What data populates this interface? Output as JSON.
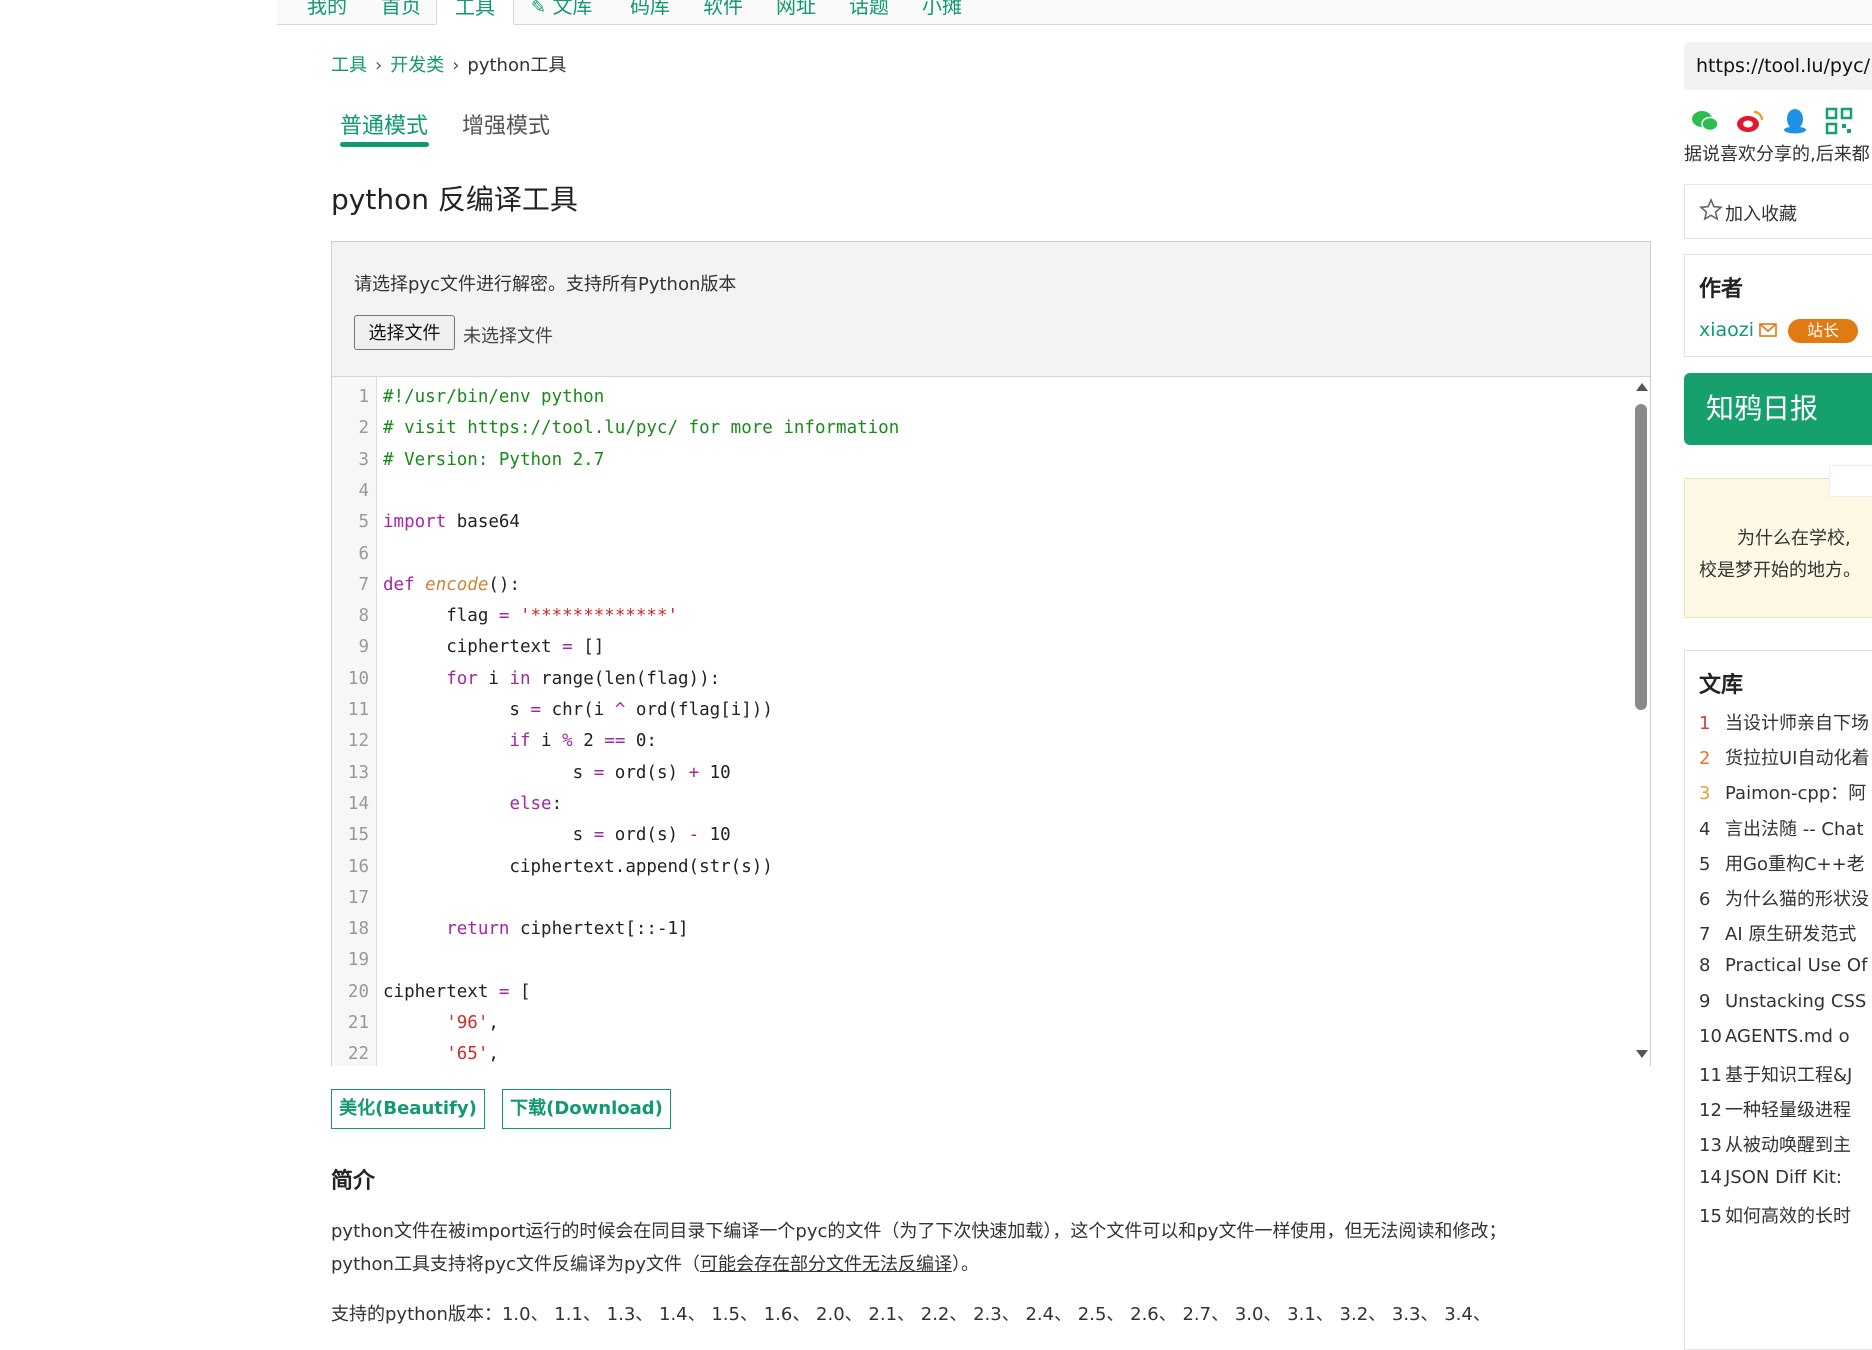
{
  "nav": {
    "items": [
      "我的",
      "首页",
      "工具",
      "文库",
      "码库",
      "软件",
      "网址",
      "话题",
      "小摊"
    ],
    "active_index": 2
  },
  "breadcrumb": {
    "tools": "工具",
    "dev": "开发类",
    "current": "python工具",
    "sep": "›"
  },
  "tabs": {
    "normal": "普通模式",
    "enhanced": "增强模式"
  },
  "page_title": "python 反编译工具",
  "panel": {
    "hint": "请选择pyc文件进行解密。支持所有Python版本",
    "file_button": "选择文件",
    "file_status": "未选择文件"
  },
  "code_lines": [
    {
      "n": "1",
      "parts": [
        [
          "c-com",
          "#!/usr/bin/env python"
        ]
      ]
    },
    {
      "n": "2",
      "parts": [
        [
          "c-com",
          "# visit https://tool.lu/pyc/ for more information"
        ]
      ]
    },
    {
      "n": "3",
      "parts": [
        [
          "c-com",
          "# Version: Python 2.7"
        ]
      ]
    },
    {
      "n": "4",
      "parts": []
    },
    {
      "n": "5",
      "parts": [
        [
          "c-kw",
          "import"
        ],
        [
          "",
          " base64"
        ]
      ]
    },
    {
      "n": "6",
      "parts": []
    },
    {
      "n": "7",
      "parts": [
        [
          "c-kw",
          "def"
        ],
        [
          "",
          " "
        ],
        [
          "c-fn",
          "encode"
        ],
        [
          "",
          "():"
        ]
      ]
    },
    {
      "n": "8",
      "parts": [
        [
          "",
          "      flag "
        ],
        [
          "c-op",
          "="
        ],
        [
          "",
          " "
        ],
        [
          "c-str",
          "'*************'"
        ]
      ]
    },
    {
      "n": "9",
      "parts": [
        [
          "",
          "      ciphertext "
        ],
        [
          "c-op",
          "="
        ],
        [
          "",
          " []"
        ]
      ]
    },
    {
      "n": "10",
      "parts": [
        [
          "",
          "      "
        ],
        [
          "c-kw",
          "for"
        ],
        [
          "",
          " i "
        ],
        [
          "c-kw",
          "in"
        ],
        [
          "",
          " range(len(flag)):"
        ]
      ]
    },
    {
      "n": "11",
      "parts": [
        [
          "",
          "            s "
        ],
        [
          "c-op",
          "="
        ],
        [
          "",
          " chr(i "
        ],
        [
          "c-op",
          "^"
        ],
        [
          "",
          " ord(flag[i]))"
        ]
      ]
    },
    {
      "n": "12",
      "parts": [
        [
          "",
          "            "
        ],
        [
          "c-kw",
          "if"
        ],
        [
          "",
          " i "
        ],
        [
          "c-op",
          "%"
        ],
        [
          "",
          " 2 "
        ],
        [
          "c-op",
          "=="
        ],
        [
          "",
          " 0:"
        ]
      ]
    },
    {
      "n": "13",
      "parts": [
        [
          "",
          "                  s "
        ],
        [
          "c-op",
          "="
        ],
        [
          "",
          " ord(s) "
        ],
        [
          "c-op",
          "+"
        ],
        [
          "",
          " 10"
        ]
      ]
    },
    {
      "n": "14",
      "parts": [
        [
          "",
          "            "
        ],
        [
          "c-kw",
          "else"
        ],
        [
          "",
          ":"
        ]
      ]
    },
    {
      "n": "15",
      "parts": [
        [
          "",
          "                  s "
        ],
        [
          "c-op",
          "="
        ],
        [
          "",
          " ord(s) "
        ],
        [
          "c-op",
          "-"
        ],
        [
          "",
          " 10"
        ]
      ]
    },
    {
      "n": "16",
      "parts": [
        [
          "",
          "            ciphertext.append(str(s))"
        ]
      ]
    },
    {
      "n": "17",
      "parts": []
    },
    {
      "n": "18",
      "parts": [
        [
          "",
          "      "
        ],
        [
          "c-kw",
          "return"
        ],
        [
          "",
          " ciphertext[::-1]"
        ]
      ]
    },
    {
      "n": "19",
      "parts": []
    },
    {
      "n": "20",
      "parts": [
        [
          "",
          "ciphertext "
        ],
        [
          "c-op",
          "="
        ],
        [
          "",
          " ["
        ]
      ]
    },
    {
      "n": "21",
      "parts": [
        [
          "",
          "      "
        ],
        [
          "c-str",
          "'96'"
        ],
        [
          "",
          ","
        ]
      ]
    },
    {
      "n": "22",
      "parts": [
        [
          "",
          "      "
        ],
        [
          "c-str",
          "'65'"
        ],
        [
          "",
          ","
        ]
      ]
    }
  ],
  "actions": {
    "beautify": "美化(Beautify)",
    "download": "下载(Download)"
  },
  "intro": {
    "heading": "简介",
    "p1": "python文件在被import运行的时候会在同目录下编译一个pyc的文件（为了下次快速加载），这个文件可以和py文件一样使用，但无法阅读和修改；",
    "p2_a": "python工具支持将pyc文件反编译为py文件（",
    "p2_link": "可能会存在部分文件无法反编译",
    "p2_b": "）。",
    "p3": "支持的python版本：1.0、 1.1、 1.3、 1.4、 1.5、 1.6、 2.0、 2.1、 2.2、 2.3、 2.4、 2.5、 2.6、 2.7、 3.0、 3.1、 3.2、 3.3、 3.4、"
  },
  "sidebar": {
    "url": "https://tool.lu/pyc/",
    "share_icons": [
      "wechat-icon",
      "weibo-icon",
      "qq-icon",
      "qrcode-icon",
      "bookmark-icon"
    ],
    "share_note": "据说喜欢分享的,后来都",
    "favorite": "加入收藏",
    "author_heading": "作者",
    "author_name": "xiaozi",
    "author_badge": "站长",
    "daily": "知鸦日报",
    "note_line1": "为什么在学校,",
    "note_line2": "校是梦开始的地方。",
    "lib_heading": "文库",
    "lib_items": [
      {
        "n": "1",
        "title": "当设计师亲自下场",
        "color": "#e03b3b"
      },
      {
        "n": "2",
        "title": "货拉拉UI自动化着",
        "color": "#e8732a"
      },
      {
        "n": "3",
        "title": "Paimon-cpp：阿",
        "color": "#e8a32a"
      },
      {
        "n": "4",
        "title": "言出法随 -- Chat",
        "color": "#333333"
      },
      {
        "n": "5",
        "title": "用Go重构C++老",
        "color": "#333333"
      },
      {
        "n": "6",
        "title": "为什么猫的形状没",
        "color": "#333333"
      },
      {
        "n": "7",
        "title": "AI 原生研发范式",
        "color": "#333333"
      },
      {
        "n": "8",
        "title": "Practical Use Of",
        "color": "#333333"
      },
      {
        "n": "9",
        "title": "Unstacking CSS",
        "color": "#333333"
      },
      {
        "n": "10",
        "title": "AGENTS.md o",
        "color": "#333333"
      },
      {
        "n": "11",
        "title": "基于知识工程&J",
        "color": "#333333"
      },
      {
        "n": "12",
        "title": "一种轻量级进程",
        "color": "#333333"
      },
      {
        "n": "13",
        "title": "从被动唤醒到主",
        "color": "#333333"
      },
      {
        "n": "14",
        "title": "JSON Diff Kit:",
        "color": "#333333"
      },
      {
        "n": "15",
        "title": "如何高效的长时",
        "color": "#333333"
      }
    ]
  },
  "colors": {
    "accent": "#119a6e",
    "badge": "#e07a12"
  }
}
